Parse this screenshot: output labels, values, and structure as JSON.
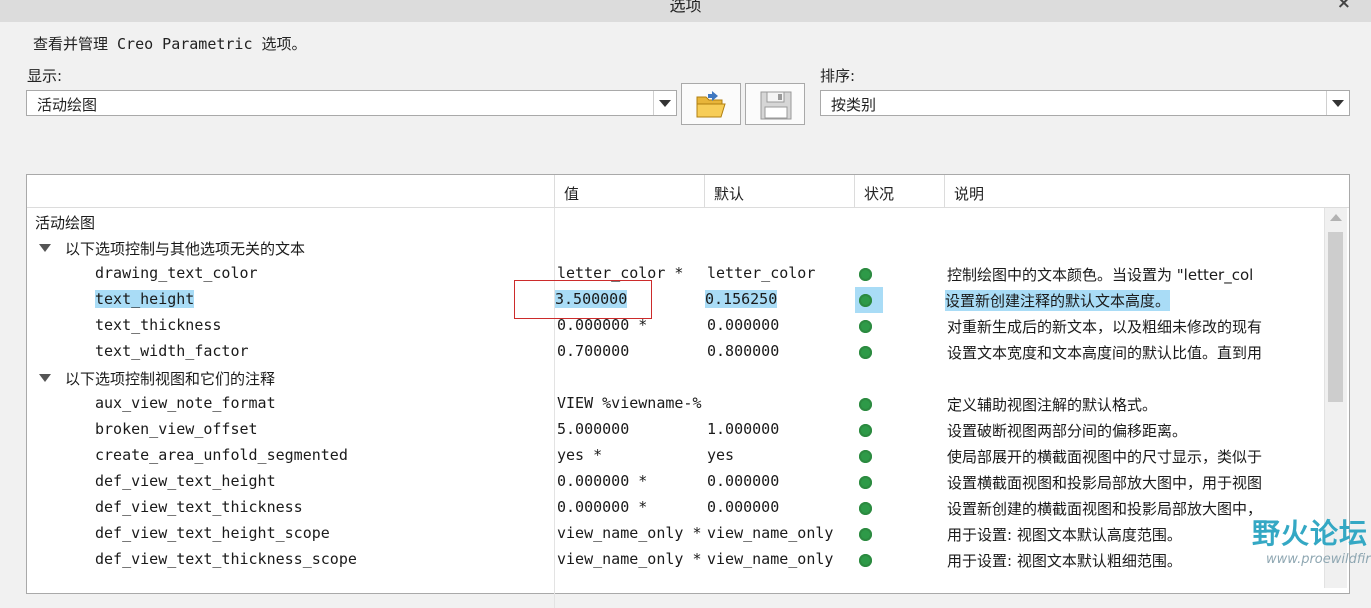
{
  "window": {
    "title": "选项",
    "close_symbol": "×"
  },
  "description": "查看并管理 Creo Parametric 选项。",
  "show": {
    "label": "显示:",
    "value": "活动绘图"
  },
  "sort": {
    "label": "排序:",
    "value": "按类别"
  },
  "table": {
    "headers": {
      "value": "值",
      "default": "默认",
      "status": "状况",
      "note": "说明"
    },
    "category": "活动绘图",
    "groups": [
      {
        "title": "以下选项控制与其他选项无关的文本",
        "rows": [
          {
            "name": "drawing_text_color",
            "value": "letter_color *",
            "default": "letter_color",
            "note": "控制绘图中的文本颜色。当设置为 \"letter_col"
          },
          {
            "name": "text_height",
            "value": "3.500000",
            "default": "0.156250",
            "note": "设置新创建注释的默认文本高度。"
          },
          {
            "name": "text_thickness",
            "value": "0.000000 *",
            "default": "0.000000",
            "note": "对重新生成后的新文本，以及粗细未修改的现有"
          },
          {
            "name": "text_width_factor",
            "value": "0.700000",
            "default": "0.800000",
            "note": "设置文本宽度和文本高度间的默认比值。直到用"
          }
        ]
      },
      {
        "title": "以下选项控制视图和它们的注释",
        "rows": [
          {
            "name": "aux_view_note_format",
            "value": "VIEW %viewname-%",
            "default": "",
            "note": "定义辅助视图注解的默认格式。"
          },
          {
            "name": "broken_view_offset",
            "value": "5.000000",
            "default": "1.000000",
            "note": "设置破断视图两部分间的偏移距离。"
          },
          {
            "name": "create_area_unfold_segmented",
            "value": "yes *",
            "default": "yes",
            "note": "使局部展开的横截面视图中的尺寸显示，类似于"
          },
          {
            "name": "def_view_text_height",
            "value": "0.000000 *",
            "default": "0.000000",
            "note": "设置横截面视图和投影局部放大图中，用于视图"
          },
          {
            "name": "def_view_text_thickness",
            "value": "0.000000 *",
            "default": "0.000000",
            "note": "设置新创建的横截面视图和投影局部放大图中，"
          },
          {
            "name": "def_view_text_height_scope",
            "value": "view_name_only *",
            "default": "view_name_only",
            "note": "用于设置: 视图文本默认高度范围。"
          },
          {
            "name": "def_view_text_thickness_scope",
            "value": "view_name_only *",
            "default": "view_name_only",
            "note": "用于设置: 视图文本默认粗细范围。"
          }
        ]
      }
    ]
  },
  "watermark": {
    "text": "野火论坛",
    "url": "www.proewildfire.cn"
  },
  "colors": {
    "selection": "#a9dcf6",
    "status_ok": "#2e9a48",
    "highlight_box": "#cc2b2b"
  }
}
